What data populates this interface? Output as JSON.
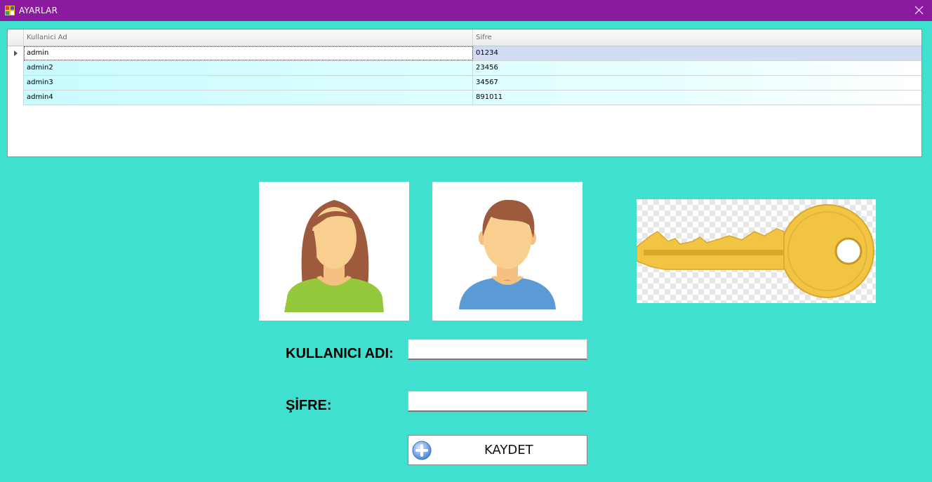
{
  "window": {
    "title": "AYARLAR"
  },
  "grid": {
    "columns": [
      "Kullanici Ad",
      "Sifre"
    ],
    "rows": [
      {
        "kullanici": "admin",
        "sifre": "01234"
      },
      {
        "kullanici": "admin2",
        "sifre": "23456"
      },
      {
        "kullanici": "admin3",
        "sifre": "34567"
      },
      {
        "kullanici": "admin4",
        "sifre": "891011"
      }
    ],
    "selected_row": 0
  },
  "images": {
    "female": "female-avatar-icon",
    "male": "male-avatar-icon",
    "key": "key-icon"
  },
  "form": {
    "username_label": "KULLANICI ADI:",
    "username_value": "",
    "password_label": "ŞİFRE:",
    "password_value": "",
    "save_button": "KAYDET",
    "save_icon": "plus-circle-icon"
  },
  "colors": {
    "titlebar": "#8A1B9E",
    "background": "#40E0D0",
    "selection": "#D2DCF5"
  }
}
